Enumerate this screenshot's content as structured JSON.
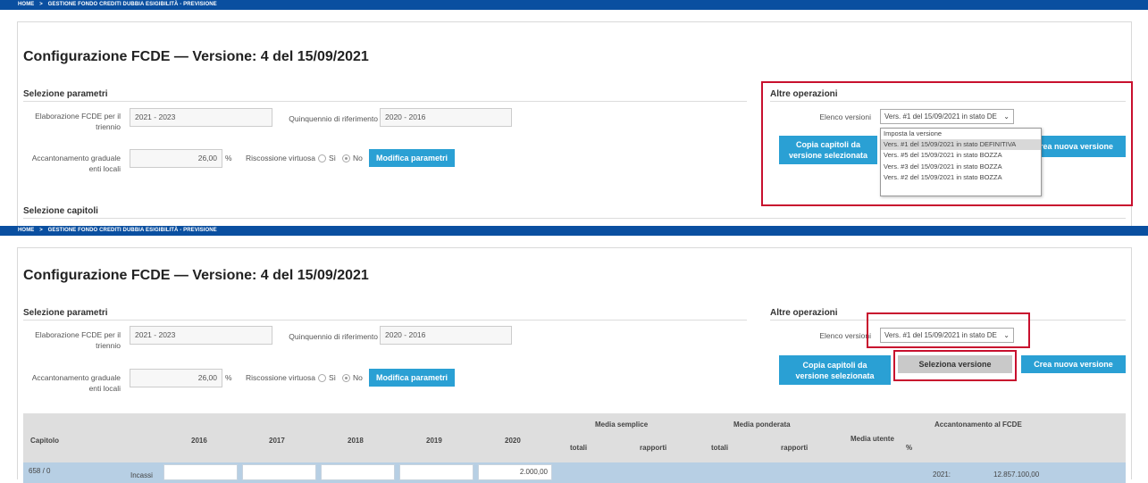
{
  "breadcrumb": {
    "home": "HOME",
    "sep": ">",
    "current": "GESTIONE FONDO CREDITI DUBBIA ESIGIBILITÀ - PREVISIONE"
  },
  "page": {
    "title": "Configurazione FCDE — Versione: 4 del 15/09/2021"
  },
  "params": {
    "section": "Selezione parametri",
    "triennio_label_1": "Elaborazione FCDE per il",
    "triennio_label_2": "triennio",
    "triennio_value": "2021 - 2023",
    "quinquennio_label": "Quinquennio di riferimento",
    "quinquennio_value": "2020 - 2016",
    "acc_label_1": "Accantonamento graduale",
    "acc_label_2": "enti locali",
    "acc_value": "26,00",
    "pct": "%",
    "riscossione_label": "Riscossione virtuosa",
    "si": "Sì",
    "no": "No",
    "modifica": "Modifica parametri"
  },
  "capitoli": {
    "section": "Selezione capitoli"
  },
  "altre": {
    "section": "Altre operazioni",
    "elenco_label": "Elenco versioni",
    "selected": "Vers. #1 del 15/09/2021 in stato DE",
    "copia_1": "Copia capitoli da",
    "copia_2": "versione selezionata",
    "seleziona": "Seleziona versione",
    "crea": "Crea nuova versione",
    "crea_partial": "rea nuova versione",
    "options": [
      "Imposta la versione",
      "Vers. #1 del 15/09/2021 in stato DEFINITIVA",
      "Vers. #5 del 15/09/2021 in stato BOZZA",
      "Vers. #3 del 15/09/2021 in stato BOZZA",
      "Vers. #2 del 15/09/2021 in stato BOZZA"
    ]
  },
  "table": {
    "capitolo": "Capitolo",
    "years": [
      "2016",
      "2017",
      "2018",
      "2019",
      "2020"
    ],
    "media_semplice": "Media semplice",
    "media_ponderata": "Media ponderata",
    "totali": "totali",
    "rapporti": "rapporti",
    "media_utente": "Media utente",
    "accantonamento": "Accantonamento al FCDE",
    "pct": "%",
    "row": {
      "capitolo": "658 / 0",
      "tipo": "Incassi",
      "v2020": "2.000,00",
      "anno": "2021:",
      "importo": "12.857.100,00"
    }
  }
}
